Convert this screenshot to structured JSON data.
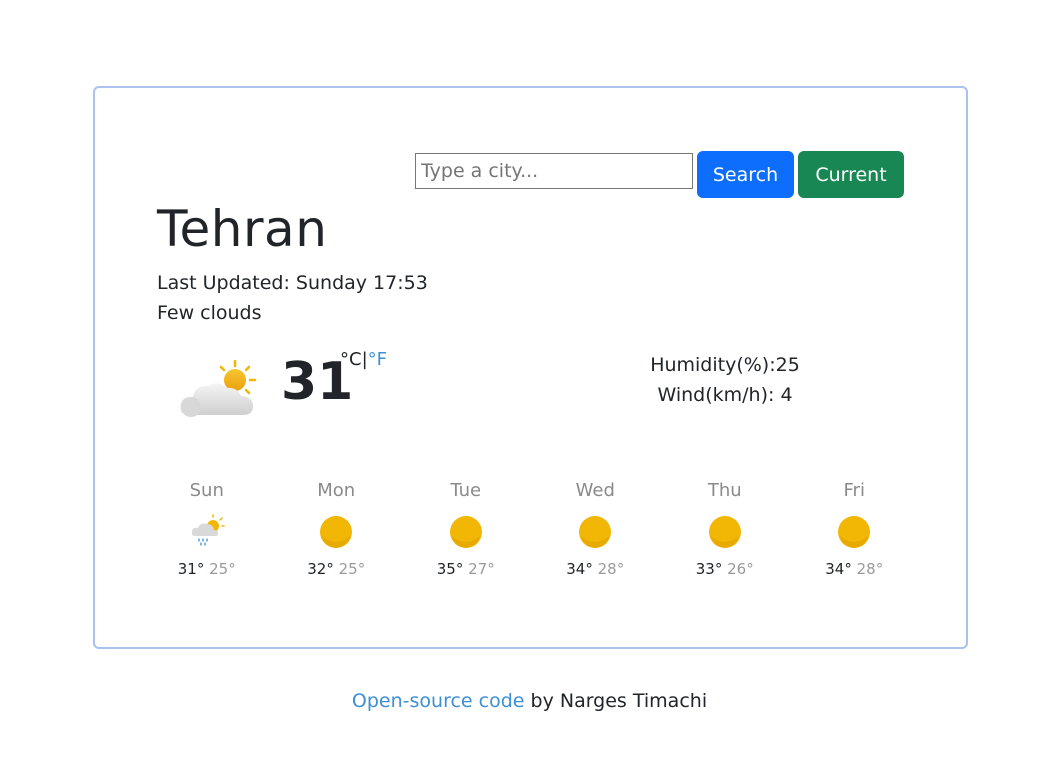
{
  "search": {
    "placeholder": "Type a city...",
    "value": "",
    "search_label": "Search",
    "current_label": "Current"
  },
  "weather": {
    "city": "Tehran",
    "last_updated": "Last Updated: Sunday 17:53",
    "description": "Few clouds",
    "icon": "few-clouds-day-icon",
    "temperature": "31",
    "unit_c": "°C",
    "unit_sep": "|",
    "unit_f": "°F",
    "humidity": "Humidity(%):25",
    "wind": "Wind(km/h): 4"
  },
  "forecast": [
    {
      "day": "Sun",
      "max": "31°",
      "min": "25°",
      "icon": "rain-cloud-sun-icon"
    },
    {
      "day": "Mon",
      "max": "32°",
      "min": "25°",
      "icon": "sun-icon"
    },
    {
      "day": "Tue",
      "max": "35°",
      "min": "27°",
      "icon": "sun-icon"
    },
    {
      "day": "Wed",
      "max": "34°",
      "min": "28°",
      "icon": "sun-icon"
    },
    {
      "day": "Thu",
      "max": "33°",
      "min": "26°",
      "icon": "sun-icon"
    },
    {
      "day": "Fri",
      "max": "34°",
      "min": "28°",
      "icon": "sun-icon"
    }
  ],
  "footer": {
    "link_text": "Open-source code",
    "suffix": " by Narges Timachi"
  },
  "colors": {
    "search_button": "#0d6efd",
    "current_button": "#198754",
    "link": "#3d8fd6",
    "card_border": "#a9c2ee",
    "sun": "#f2b705"
  }
}
